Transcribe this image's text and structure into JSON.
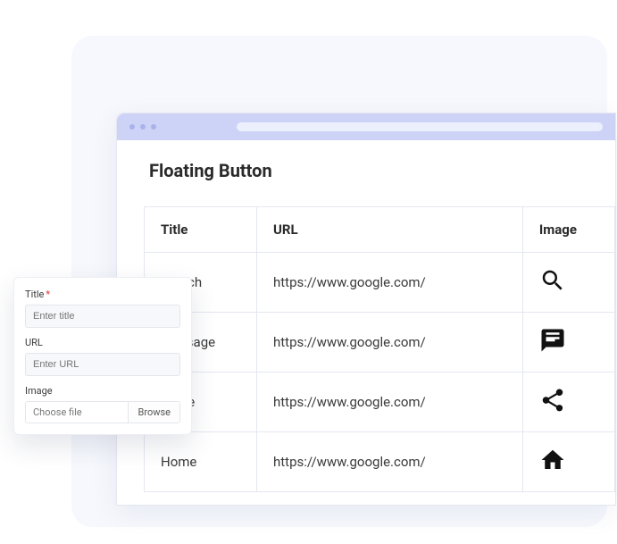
{
  "page": {
    "title": "Floating Button"
  },
  "table": {
    "headers": {
      "title": "Title",
      "url": "URL",
      "image": "Image"
    },
    "rows": [
      {
        "title": "Search",
        "url": "https://www.google.com/",
        "icon": "search"
      },
      {
        "title": "Message",
        "url": "https://www.google.com/",
        "icon": "chat"
      },
      {
        "title": "Share",
        "url": "https://www.google.com/",
        "icon": "share"
      },
      {
        "title": "Home",
        "url": "https://www.google.com/",
        "icon": "home"
      }
    ]
  },
  "form": {
    "title_label": "Title",
    "title_placeholder": "Enter title",
    "url_label": "URL",
    "url_placeholder": "Enter URL",
    "image_label": "Image",
    "file_placeholder": "Choose file",
    "browse_label": "Browse"
  }
}
